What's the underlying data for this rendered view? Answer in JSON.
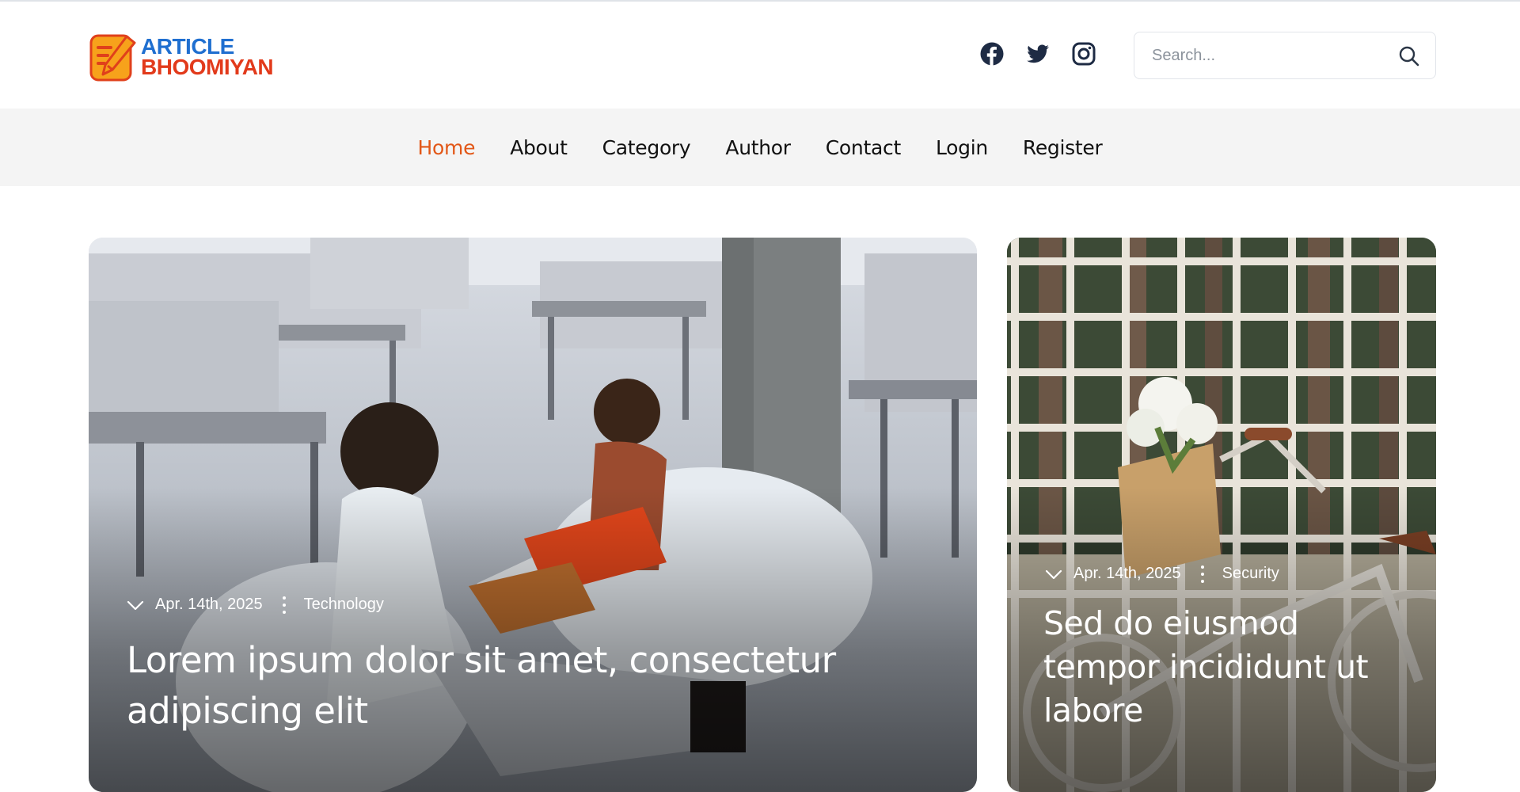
{
  "brand": {
    "line1": "ARTICLE",
    "line2": "BHOOMIYAN"
  },
  "social": [
    {
      "icon": "facebook-icon"
    },
    {
      "icon": "twitter-icon"
    },
    {
      "icon": "instagram-icon"
    }
  ],
  "search": {
    "placeholder": "Search...",
    "value": "",
    "icon": "search-icon"
  },
  "nav": {
    "items": [
      {
        "label": "Home",
        "active": true
      },
      {
        "label": "About"
      },
      {
        "label": "Category"
      },
      {
        "label": "Author"
      },
      {
        "label": "Contact"
      },
      {
        "label": "Login"
      },
      {
        "label": "Register"
      }
    ]
  },
  "featured": [
    {
      "date": "Apr. 14th, 2025",
      "category": "Technology",
      "title": "Lorem ipsum dolor sit amet, consectetur adipiscing elit"
    },
    {
      "date": "Apr. 14th, 2025",
      "category": "Security",
      "title": "Sed do eiusmod tempor incididunt ut labore"
    }
  ],
  "colors": {
    "accent": "#e25717",
    "brand_blue": "#1f6fd0",
    "brand_red": "#e23a1b",
    "nav_bg": "#f4f4f4",
    "icon_dark": "#1e2b44"
  }
}
